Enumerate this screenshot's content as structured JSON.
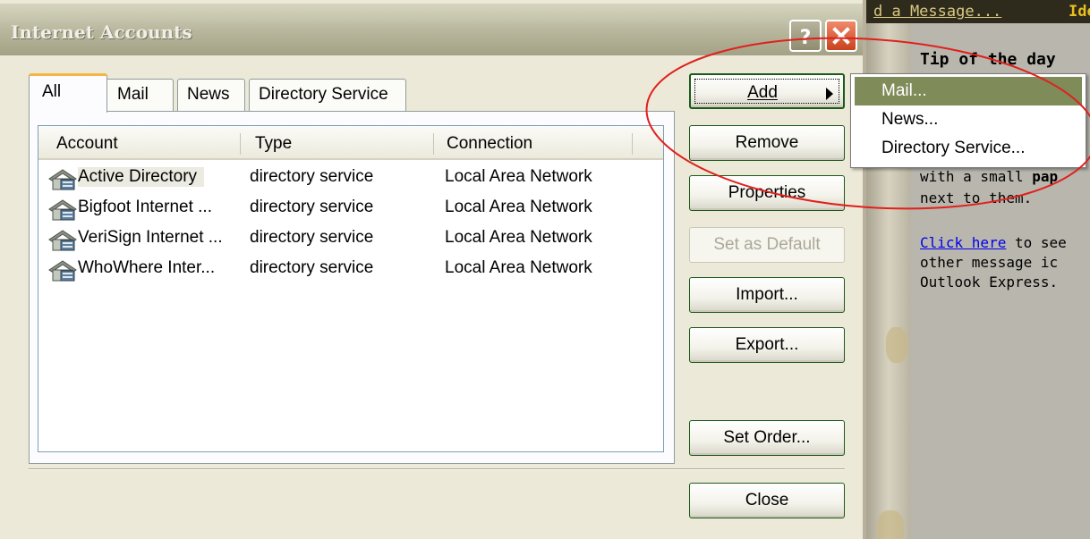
{
  "background": {
    "link_text": "d a Message...",
    "link2_text": "Ide",
    "tip_title": "Tip of the day",
    "tip_line1_pre": "with a small ",
    "tip_line1_bold": "pap",
    "tip_line2": "next to them.",
    "tip_link": "Click here",
    "tip_line3_rest": " to see",
    "tip_line4": "other message ic",
    "tip_line5": "Outlook Express."
  },
  "dialog": {
    "title": "Internet Accounts",
    "help_icon": "question-icon",
    "close_icon": "close-icon"
  },
  "tabs": [
    {
      "label": "All",
      "selected": true
    },
    {
      "label": "Mail",
      "selected": false
    },
    {
      "label": "News",
      "selected": false
    },
    {
      "label": "Directory Service",
      "selected": false
    }
  ],
  "list": {
    "columns": [
      "Account",
      "Type",
      "Connection"
    ],
    "rows": [
      {
        "name": "Active Directory",
        "type": "directory service",
        "connection": "Local Area Network",
        "selected": true
      },
      {
        "name": "Bigfoot Internet ...",
        "type": "directory service",
        "connection": "Local Area Network"
      },
      {
        "name": "VeriSign Internet ...",
        "type": "directory service",
        "connection": "Local Area Network"
      },
      {
        "name": "WhoWhere Inter...",
        "type": "directory service",
        "connection": "Local Area Network"
      }
    ]
  },
  "buttons": {
    "add": "Add",
    "remove": "Remove",
    "properties": "Properties",
    "set_default": "Set as Default",
    "import": "Import...",
    "export": "Export...",
    "set_order": "Set Order...",
    "close": "Close"
  },
  "add_menu": [
    "Mail...",
    "News...",
    "Directory Service..."
  ],
  "colors": {
    "annotation": "#e0201c",
    "menu_highlight": "#7f8b58",
    "button_border": "#1c5a1c"
  }
}
